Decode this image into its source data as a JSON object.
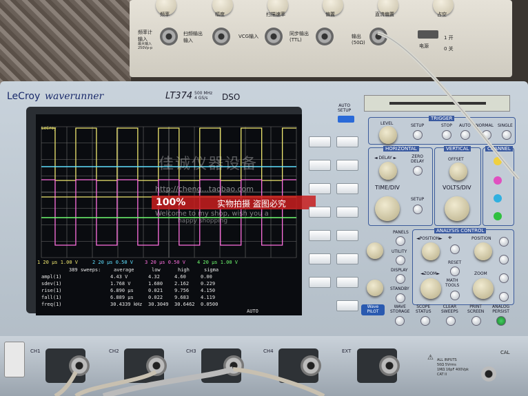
{
  "generator": {
    "top_labels": [
      "频率",
      "幅度",
      "扫描速率",
      "偏置",
      "直流偏置",
      "占空"
    ],
    "inputs": [
      {
        "label": "频率计\n输入",
        "sub": "最大输入\n250Vp-p"
      },
      {
        "label": "扫频输出\n输入"
      },
      {
        "label": "VCG输入"
      },
      {
        "label": "同步输出\n(TTL)"
      },
      {
        "label": "输出\n(50Ω)"
      }
    ],
    "power_label": "电源",
    "power_states": [
      "1 开",
      "0 关"
    ]
  },
  "scope": {
    "brand": "LeCroy",
    "series": "waverunner",
    "model": "LT374",
    "spec_line1": "500 MHz",
    "spec_line2": "4 GS/s",
    "dso": "DSO",
    "auto_setup": "AUTO\nSETUP",
    "screen": {
      "brand_tag": "LeCroy",
      "channel_line": [
        {
          "text": "1 20 µs 1.00 V",
          "color": "#f0e870"
        },
        {
          "text": "2 20 µs 0.50 V",
          "color": "#60e0ff"
        },
        {
          "text": "3 20 µs 0.50 V",
          "color": "#ff70e0"
        },
        {
          "text": "4 20 µs 1.00 V",
          "color": "#70ff70"
        }
      ],
      "sweeps_header": "389 sweeps:",
      "stat_headers": [
        "average",
        "low",
        "high",
        "sigma"
      ],
      "measurements": [
        {
          "name": "ampl(1)",
          "average": "4.43 V",
          "low": "4.32",
          "high": "4.60",
          "sigma": "0.00"
        },
        {
          "name": "sdev(1)",
          "average": "1.768 V",
          "low": "1.680",
          "high": "2.162",
          "sigma": "0.229"
        },
        {
          "name": "rise(1)",
          "average": "6.890 µs",
          "low": "0.021",
          "high": "9.756",
          "sigma": "4.150"
        },
        {
          "name": "fall(1)",
          "average": "6.889 µs",
          "low": "0.022",
          "high": "9.683",
          "sigma": "4.119"
        },
        {
          "name": "freq(1)",
          "average": "30.4339 kHz",
          "low": "30.3049",
          "high": "30.6462",
          "sigma": "0.0500"
        }
      ],
      "mode": "AUTO"
    },
    "trigger": {
      "title": "TRIGGER",
      "level": "LEVEL",
      "setup": "SETUP",
      "stop": "STOP",
      "auto": "AUTO",
      "normal": "NORMAL",
      "single": "SINGLE"
    },
    "horizontal": {
      "title": "HORIZONTAL",
      "delay": "◄ DELAY ►",
      "zero_delay": "ZERO\nDELAY",
      "time_div": "TIME/DIV",
      "setup": "SETUP"
    },
    "vertical": {
      "title": "VERTICAL",
      "offset": "OFFSET",
      "volts_div": "VOLTS/DIV",
      "channel": "CHANNEL"
    },
    "analysis": {
      "title": "ANALYSIS CONTROL",
      "panels": "PANELS",
      "utility": "UTILITY",
      "display": "DISPLAY",
      "standby": "STANDBY",
      "position_left": "◄POSITION►",
      "position_right": "POSITION",
      "reset": "RESET",
      "zoom_left": "◄ZOOM►",
      "zoom_right": "ZOOM",
      "math_tools": "MATH\nTOOLS"
    },
    "bottom_buttons": [
      "WAVE\nSTORAGE",
      "SCOPE\nSTATUS",
      "CLEAR\nSWEEPS",
      "PRINT\nSCREEN",
      "ANALOG\nPERSIST"
    ],
    "wavepilot": "Wave\nPILOT",
    "channel_ports": [
      "CH1",
      "CH2",
      "CH3",
      "CH4",
      "EXT"
    ],
    "input_spec": "ALL INPUTS\n50Ω 5Vrms\n1MΩ 16pF 400Vpk\nCAT II",
    "cal": "CAL"
  },
  "watermark": {
    "shop_name": "佳诚仪器设备",
    "url": "http://cheng...taobao.com",
    "badge_pct": "100%",
    "badge_text": "实物拍摄 盗图必究",
    "welcome": "Welcome to my shop, wish you a",
    "happy": "happy shopping"
  },
  "colors": {
    "ch1": "#f0e870",
    "ch2": "#60e0ff",
    "ch3": "#ff70e0",
    "ch4": "#70ff70",
    "grid": "#707070"
  }
}
